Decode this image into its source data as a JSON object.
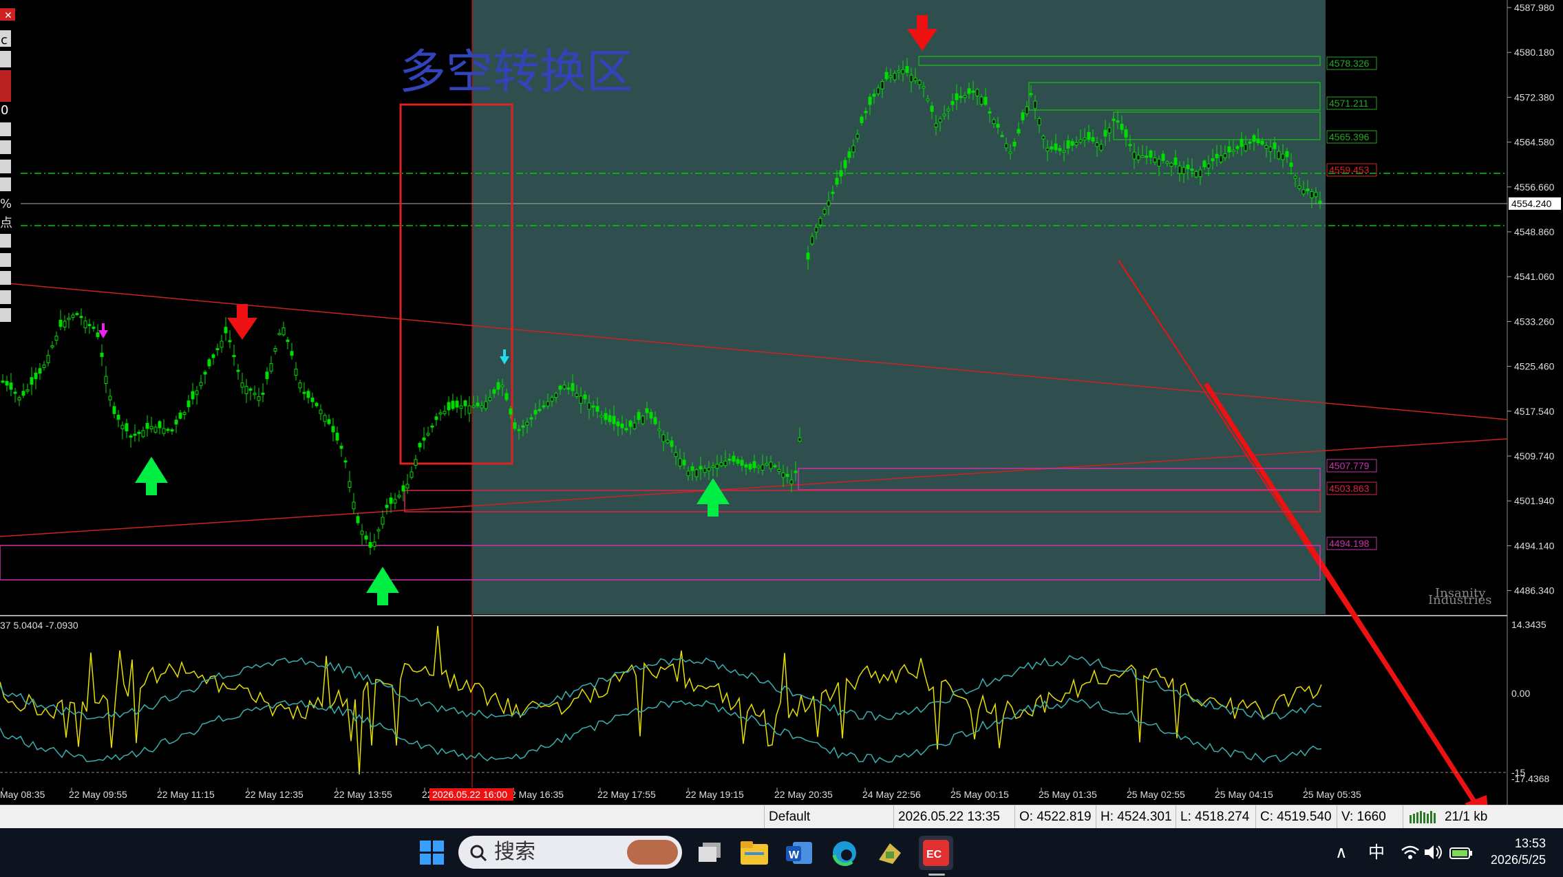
{
  "window": {
    "close_glyph": "✕"
  },
  "chart": {
    "zone_label": "多空转换区",
    "watermark": "Insanity Industries",
    "price_labels": [
      "4587.980",
      "4580.180",
      "4572.380",
      "4564.580",
      "4556.660",
      "4548.860",
      "4541.060",
      "4533.260",
      "4525.460",
      "4517.540",
      "4509.740",
      "4501.940",
      "4494.140",
      "4486.340"
    ],
    "current_price": "4554.240",
    "level_tags": [
      {
        "text": "4578.326",
        "color": "#22aa22"
      },
      {
        "text": "4571.211",
        "color": "#22aa22"
      },
      {
        "text": "4565.396",
        "color": "#22aa22"
      },
      {
        "text": "4559.453",
        "color": "#dd2222"
      },
      {
        "text": "4507.779",
        "color": "#cc33aa"
      },
      {
        "text": "4503.863",
        "color": "#dd2244"
      },
      {
        "text": "4494.198",
        "color": "#cc33aa"
      }
    ],
    "osc_header": "37 5.0404 -7.0930",
    "osc_scale": [
      "14.3435",
      "0.00",
      "-15",
      "-17.4368"
    ],
    "time_labels": [
      "May 08:35",
      "22 May 09:55",
      "22 May 11:15",
      "22 May 12:35",
      "22 May 13:55",
      "22",
      "2 May 16:35",
      "22 May 17:55",
      "22 May 19:15",
      "22 May 20:35",
      "24 May 22:56",
      "25 May 00:15",
      "25 May 01:35",
      "25 May 02:55",
      "25 May 04:15",
      "25 May 05:35"
    ],
    "cursor_time": "2026.05.22 16:00",
    "left_panel_chars": [
      "c",
      "0",
      "%",
      "点"
    ],
    "colors": {
      "bg": "#000000",
      "shade": "#2f4f4f",
      "candle": "#00dd00",
      "grid": "#00cc00",
      "trendline": "#cc2222",
      "box": "#dd2222",
      "osc_yellow": "#e8e000",
      "osc_cyan": "#3ab0b0"
    }
  },
  "status": {
    "profile": "Default",
    "datetime": "2026.05.22 13:35",
    "open": "O: 4522.819",
    "high": "H: 4524.301",
    "low": "L: 4518.274",
    "close": "C: 4519.540",
    "volume": "V: 1660",
    "conn": "21/1 kb"
  },
  "taskbar": {
    "search_placeholder": "搜索",
    "tray_chevron": "∧",
    "ime": "中",
    "time": "13:53",
    "date": "2026/5/25"
  }
}
